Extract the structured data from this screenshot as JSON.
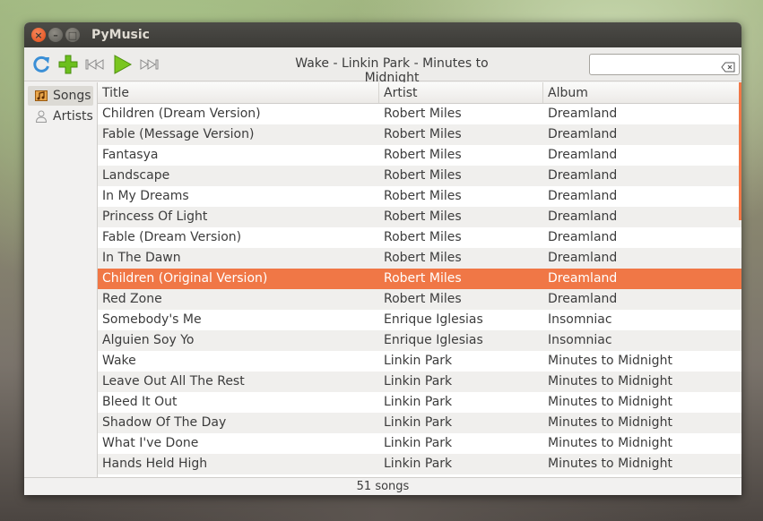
{
  "window": {
    "title": "PyMusic"
  },
  "toolbar": {
    "now_playing": "Wake - Linkin Park - Minutes to Midnight",
    "search_value": ""
  },
  "icons": {
    "refresh": "refresh-icon",
    "add": "plus-icon",
    "previous": "skip-back-icon",
    "play": "play-icon",
    "next": "skip-forward-icon",
    "clear": "clear-icon"
  },
  "colors": {
    "accent": "#f07746",
    "titlebar": "#3c3b37",
    "add_green": "#6cbf1e",
    "refresh_blue": "#3a8fd6"
  },
  "sidebar": {
    "items": [
      {
        "label": "Songs",
        "icon": "music-library-icon",
        "active": true
      },
      {
        "label": "Artists",
        "icon": "person-icon",
        "active": false
      }
    ]
  },
  "table": {
    "columns": [
      "Title",
      "Artist",
      "Album"
    ],
    "rows": [
      [
        "Children (Dream Version)",
        "Robert Miles",
        "Dreamland"
      ],
      [
        "Fable (Message Version)",
        "Robert Miles",
        "Dreamland"
      ],
      [
        "Fantasya",
        "Robert Miles",
        "Dreamland"
      ],
      [
        "Landscape",
        "Robert Miles",
        "Dreamland"
      ],
      [
        "In My Dreams",
        "Robert Miles",
        "Dreamland"
      ],
      [
        "Princess Of Light",
        "Robert Miles",
        "Dreamland"
      ],
      [
        "Fable (Dream Version)",
        "Robert Miles",
        "Dreamland"
      ],
      [
        "In The Dawn",
        "Robert Miles",
        "Dreamland"
      ],
      [
        "Children (Original Version)",
        "Robert Miles",
        "Dreamland"
      ],
      [
        "Red Zone",
        "Robert Miles",
        "Dreamland"
      ],
      [
        "Somebody's Me",
        "Enrique Iglesias",
        "Insomniac"
      ],
      [
        "Alguien Soy Yo",
        "Enrique Iglesias",
        "Insomniac"
      ],
      [
        "Wake",
        "Linkin Park",
        "Minutes to Midnight"
      ],
      [
        "Leave Out All The Rest",
        "Linkin Park",
        "Minutes to Midnight"
      ],
      [
        "Bleed It Out",
        "Linkin Park",
        "Minutes to Midnight"
      ],
      [
        "Shadow Of The Day",
        "Linkin Park",
        "Minutes to Midnight"
      ],
      [
        "What I've Done",
        "Linkin Park",
        "Minutes to Midnight"
      ],
      [
        "Hands Held High",
        "Linkin Park",
        "Minutes to Midnight"
      ]
    ],
    "selected_index": 8
  },
  "status": {
    "text": "51 songs"
  }
}
